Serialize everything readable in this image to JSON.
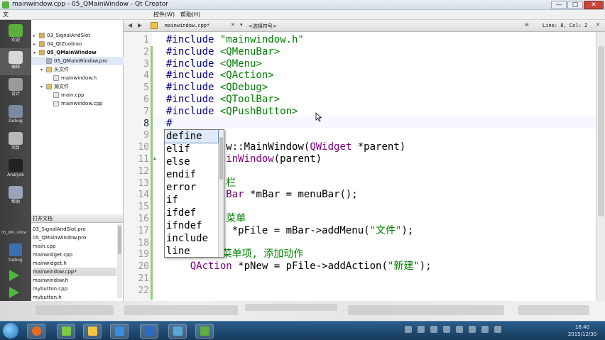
{
  "window": {
    "title": "mainwindow.cpp - 05_QMainWindow - Qt Creator",
    "controls": {
      "minimize": "—",
      "maximize": "□",
      "close": "✕"
    }
  },
  "menubar": {
    "left_fragment": "文",
    "items": [
      {
        "label": "控件(W)"
      },
      {
        "label": "帮助(H)"
      }
    ]
  },
  "modes": [
    {
      "label": "欢迎",
      "icon": "welcome-icon",
      "color": "#5cae3d"
    },
    {
      "label": "编辑",
      "icon": "edit-icon",
      "color": "#d8d8d8",
      "active": true
    },
    {
      "label": "设计",
      "icon": "design-icon",
      "color": "#9a9a9a"
    },
    {
      "label": "Debug",
      "icon": "debug-icon",
      "color": "#7a8aa0"
    },
    {
      "label": "项目",
      "icon": "projects-icon",
      "color": "#b8b8b8"
    },
    {
      "label": "Analyze",
      "icon": "analyze-icon",
      "color": "#222222"
    },
    {
      "label": "帮助",
      "icon": "help-icon",
      "color": "#9aa6b8"
    }
  ],
  "project_tree": [
    {
      "label": "03_SignalAndSlot",
      "icon": "project-icon",
      "expanded": false,
      "depth": 0
    },
    {
      "label": "04_QtZuobiao",
      "icon": "project-icon",
      "expanded": false,
      "depth": 0
    },
    {
      "label": "05_QMainWindow",
      "icon": "project-icon",
      "expanded": true,
      "depth": 0,
      "bold": true
    },
    {
      "label": "05_QMainWindow.pro",
      "icon": "pro-file-icon",
      "depth": 1,
      "selected": true
    },
    {
      "label": "头文件",
      "icon": "folder-icon",
      "expanded": true,
      "depth": 1
    },
    {
      "label": "mainwindow.h",
      "icon": "header-file-icon",
      "depth": 2
    },
    {
      "label": "源文件",
      "icon": "folder-icon",
      "expanded": true,
      "depth": 1
    },
    {
      "label": "main.cpp",
      "icon": "cpp-file-icon",
      "depth": 2
    },
    {
      "label": "mainwindow.cpp",
      "icon": "cpp-file-icon",
      "depth": 2
    }
  ],
  "open_documents": {
    "header": "打开文档",
    "items": [
      {
        "label": "03_SignalAndSlot.pro"
      },
      {
        "label": "05_QMainWindow.pro"
      },
      {
        "label": "main.cpp"
      },
      {
        "label": "mainwidget.cpp"
      },
      {
        "label": "mainwidget.h"
      },
      {
        "label": "mainwindow.cpp*",
        "selected": true
      },
      {
        "label": "mainwindow.h"
      },
      {
        "label": "mybutton.cpp"
      },
      {
        "label": "mybutton.h"
      }
    ]
  },
  "left_tools": {
    "target_label": "05_QM...ndow",
    "debug_label": "Debug",
    "icons": [
      "run-icon",
      "debug-run-icon",
      "build-icon"
    ]
  },
  "editor_toolbar": {
    "back": "◀",
    "forward": "▶",
    "filename": "mainwindow.cpp*",
    "close_file": "✕",
    "symbol_placeholder": "<选择符号>",
    "dropdown": "▾",
    "line_col": "Line: 8, Col: 2",
    "split": "⊟",
    "close": "✕"
  },
  "code": {
    "current_line": 8,
    "line_numbers": [
      "1",
      "2",
      "3",
      "4",
      "5",
      "6",
      "7",
      "8",
      "9",
      "10",
      "11",
      "12",
      "13",
      "14",
      "15",
      "16",
      "17",
      "18",
      "19",
      "20",
      "21",
      "22"
    ],
    "lines": [
      [
        {
          "t": "#include ",
          "c": "pp"
        },
        {
          "t": "\"mainwindow.h\"",
          "c": "str"
        }
      ],
      [
        {
          "t": "#include ",
          "c": "pp"
        },
        {
          "t": "<QMenuBar>",
          "c": "str"
        }
      ],
      [
        {
          "t": "#include ",
          "c": "pp"
        },
        {
          "t": "<QMenu>",
          "c": "str"
        }
      ],
      [
        {
          "t": "#include ",
          "c": "pp"
        },
        {
          "t": "<QAction>",
          "c": "str"
        }
      ],
      [
        {
          "t": "#include ",
          "c": "pp"
        },
        {
          "t": "<QDebug>",
          "c": "str"
        }
      ],
      [
        {
          "t": "#include ",
          "c": "pp"
        },
        {
          "t": "<QToolBar>",
          "c": "str"
        }
      ],
      [
        {
          "t": "#include ",
          "c": "pp"
        },
        {
          "t": "<QPushButton>",
          "c": "str"
        }
      ],
      [
        {
          "t": "#",
          "c": "pp"
        }
      ],
      [],
      [
        {
          "t": "          ",
          "c": ""
        },
        {
          "t": "w::MainWindow(",
          "c": ""
        },
        {
          "t": "QWidget",
          "c": "typ"
        },
        {
          "t": " *parent)",
          "c": ""
        }
      ],
      [
        {
          "t": "          ",
          "c": ""
        },
        {
          "t": "inWindow",
          "c": "typ"
        },
        {
          "t": "(parent)",
          "c": ""
        }
      ],
      [],
      [
        {
          "t": "          ",
          "c": ""
        },
        {
          "t": "栏",
          "c": "cmt"
        }
      ],
      [
        {
          "t": "          ",
          "c": ""
        },
        {
          "t": "Bar",
          "c": "typ"
        },
        {
          "t": " *mBar = menuBar();",
          "c": ""
        }
      ],
      [],
      [
        {
          "t": "          ",
          "c": ""
        },
        {
          "t": "菜单",
          "c": "cmt"
        }
      ],
      [
        {
          "t": "           *pFile = mBar->addMenu(",
          "c": ""
        },
        {
          "t": "\"文件\"",
          "c": "str"
        },
        {
          "t": ");",
          "c": ""
        }
      ],
      [],
      [
        {
          "t": "    ",
          "c": ""
        },
        {
          "t": "//添加菜单项, 添加动作",
          "c": "cmt"
        }
      ],
      [
        {
          "t": "    ",
          "c": ""
        },
        {
          "t": "QAction",
          "c": "typ"
        },
        {
          "t": " *pNew = pFile->addAction(",
          "c": ""
        },
        {
          "t": "\"新建\"",
          "c": "str"
        },
        {
          "t": ");",
          "c": ""
        }
      ],
      [],
      []
    ]
  },
  "completer": {
    "items": [
      "define",
      "elif",
      "else",
      "endif",
      "error",
      "if",
      "ifdef",
      "ifndef",
      "include",
      "line"
    ],
    "selected_index": 0
  },
  "taskbar": {
    "time": "16:40",
    "date": "2015/12/30"
  }
}
